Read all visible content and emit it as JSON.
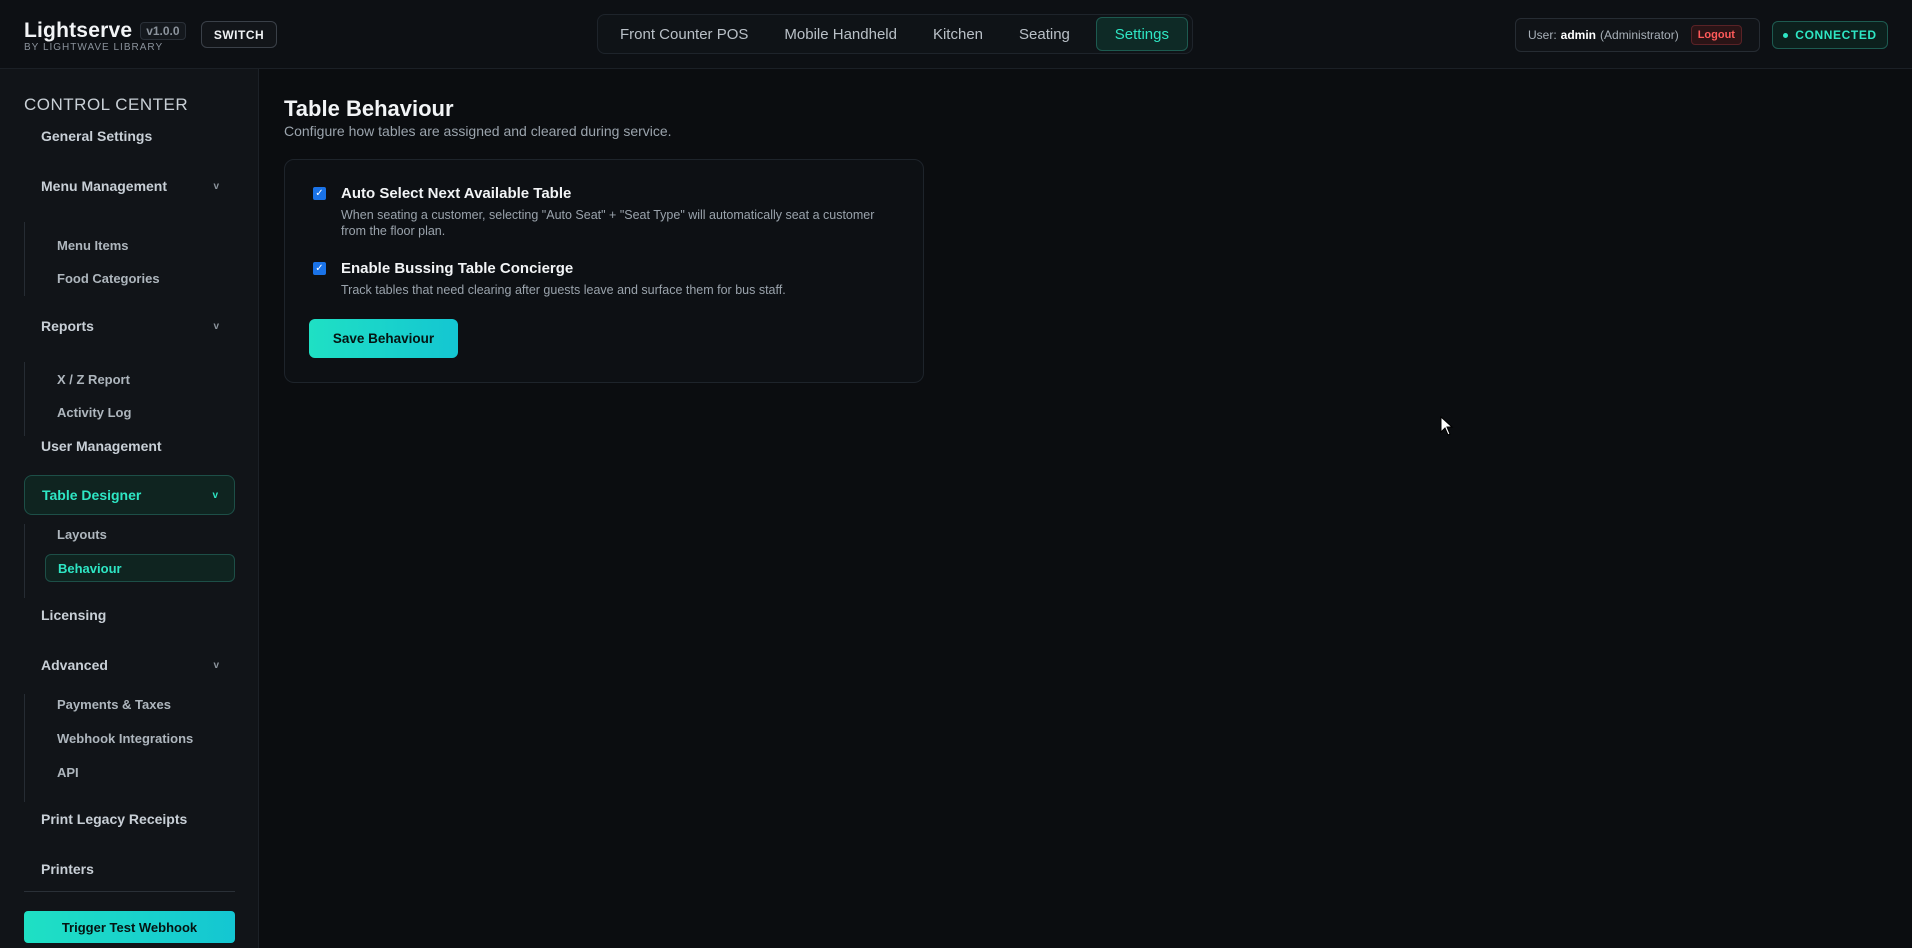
{
  "header": {
    "brand": "Lightserve",
    "version": "v1.0.0",
    "brand_sub": "BY LIGHTWAVE LIBRARY",
    "switch_label": "SWITCH",
    "tabs": [
      {
        "label": "Front Counter POS"
      },
      {
        "label": "Mobile Handheld"
      },
      {
        "label": "Kitchen"
      },
      {
        "label": "Seating"
      },
      {
        "label": "Settings",
        "active": true
      }
    ],
    "user_prefix": "User:",
    "user_name": "admin",
    "user_role": "(Administrator)",
    "logout_label": "Logout",
    "connection_status": "CONNECTED"
  },
  "sidebar": {
    "title": "CONTROL CENTER",
    "items": {
      "general": "General Settings",
      "menu": "Menu Management",
      "menu_items": "Menu Items",
      "food_categories": "Food Categories",
      "reports": "Reports",
      "xz_report": "X / Z Report",
      "activity_log": "Activity Log",
      "user_management": "User Management",
      "table_designer": "Table Designer",
      "layouts": "Layouts",
      "behaviour": "Behaviour",
      "licensing": "Licensing",
      "advanced": "Advanced",
      "payments_taxes": "Payments & Taxes",
      "webhook_integrations": "Webhook Integrations",
      "api": "API",
      "print_legacy": "Print Legacy Receipts",
      "printers": "Printers"
    },
    "chevron": "v",
    "trigger_label": "Trigger Test Webhook"
  },
  "main": {
    "title": "Table Behaviour",
    "subtitle": "Configure how tables are assigned and cleared during service.",
    "options": [
      {
        "title": "Auto Select Next Available Table",
        "description": "When seating a customer, selecting \"Auto Seat\" + \"Seat Type\" will automatically seat a customer from the floor plan.",
        "checked": true
      },
      {
        "title": "Enable Bussing Table Concierge",
        "description": "Track tables that need clearing after guests leave and surface them for bus staff.",
        "checked": true
      }
    ],
    "save_label": "Save Behaviour"
  },
  "colors": {
    "accent": "#2ee6c4",
    "background": "#0b0d10",
    "danger": "#ff5a5a",
    "checkbox": "#1a73e8"
  }
}
